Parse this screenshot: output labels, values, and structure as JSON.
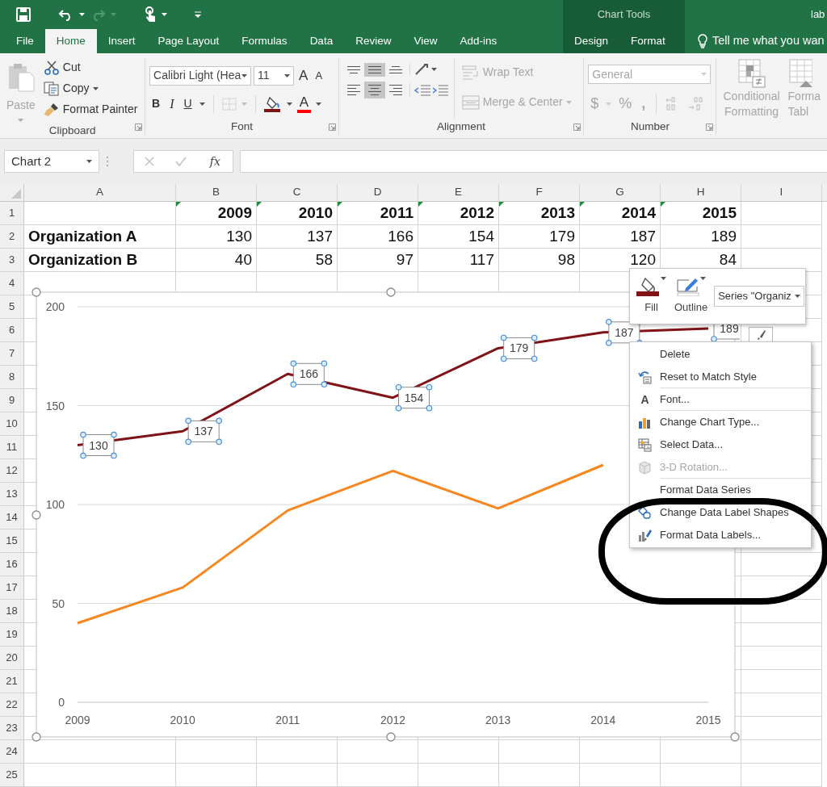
{
  "title_bar": {
    "context_group": "Chart Tools",
    "title": "lab"
  },
  "tabs": [
    {
      "label": "File",
      "selected": false,
      "kind": "standard"
    },
    {
      "label": "Home",
      "selected": true,
      "kind": "standard"
    },
    {
      "label": "Insert",
      "selected": false,
      "kind": "standard"
    },
    {
      "label": "Page Layout",
      "selected": false,
      "kind": "standard"
    },
    {
      "label": "Formulas",
      "selected": false,
      "kind": "standard"
    },
    {
      "label": "Data",
      "selected": false,
      "kind": "standard"
    },
    {
      "label": "Review",
      "selected": false,
      "kind": "standard"
    },
    {
      "label": "View",
      "selected": false,
      "kind": "standard"
    },
    {
      "label": "Add-ins",
      "selected": false,
      "kind": "standard"
    },
    {
      "label": "Design",
      "selected": false,
      "kind": "contextual"
    },
    {
      "label": "Format",
      "selected": false,
      "kind": "contextual"
    }
  ],
  "tell_me": "Tell me what you wan",
  "ribbon": {
    "clipboard": {
      "label": "Clipboard",
      "paste": {
        "label": "Paste",
        "disabled": true
      },
      "cut": "Cut",
      "copy": "Copy",
      "format_painter": "Format Painter"
    },
    "font": {
      "label": "Font",
      "font_name": "Calibri Light (Hea",
      "font_size": "11",
      "grow": "A",
      "shrink": "A",
      "bold": "B",
      "italic": "I",
      "underline": "U",
      "font_color": "A"
    },
    "alignment": {
      "label": "Alignment",
      "vertical": [
        {
          "selected": false
        },
        {
          "selected": true
        },
        {
          "selected": false
        }
      ],
      "horizontal": [
        {
          "selected": false
        },
        {
          "selected": true
        },
        {
          "selected": false
        }
      ],
      "wrap_text": "Wrap Text",
      "merge_center": "Merge & Center"
    },
    "number": {
      "label": "Number",
      "format": "General",
      "currency": "$",
      "percent": "%",
      "comma": ","
    },
    "styles": {
      "conditional_formatting": [
        "Conditional",
        "Formatting"
      ],
      "format_as_table": [
        "Forma",
        "Tabl"
      ]
    }
  },
  "formula_bar": {
    "name_box": "Chart 2",
    "function_label": "fx"
  },
  "sheet": {
    "columns": [
      "A",
      "B",
      "C",
      "D",
      "E",
      "F",
      "G",
      "H",
      "I"
    ],
    "rows": [
      {
        "header": "1",
        "kind": "years",
        "flagged": true,
        "values": [
          "2009",
          "2010",
          "2011",
          "2012",
          "2013",
          "2014",
          "2015"
        ]
      },
      {
        "header": "2",
        "kind": "data",
        "flagged": false,
        "label": "Organization A",
        "values": [
          "130",
          "137",
          "166",
          "154",
          "179",
          "187",
          "189"
        ]
      },
      {
        "header": "3",
        "kind": "data",
        "flagged": false,
        "label": "Organization B",
        "values": [
          "40",
          "58",
          "97",
          "117",
          "98",
          "120",
          "84"
        ]
      },
      {
        "header": "4",
        "kind": "blank",
        "flagged": false
      },
      {
        "header": "5",
        "kind": "blank",
        "flagged": false
      },
      {
        "header": "6",
        "kind": "blank",
        "flagged": false
      },
      {
        "header": "7",
        "kind": "blank",
        "flagged": false
      },
      {
        "header": "8",
        "kind": "blank",
        "flagged": false
      },
      {
        "header": "9",
        "kind": "blank",
        "flagged": false
      },
      {
        "header": "10",
        "kind": "blank",
        "flagged": false
      },
      {
        "header": "11",
        "kind": "blank",
        "flagged": false
      },
      {
        "header": "12",
        "kind": "blank",
        "flagged": false
      },
      {
        "header": "13",
        "kind": "blank",
        "flagged": false
      },
      {
        "header": "14",
        "kind": "blank",
        "flagged": false
      },
      {
        "header": "15",
        "kind": "blank",
        "flagged": false
      },
      {
        "header": "16",
        "kind": "blank",
        "flagged": false
      },
      {
        "header": "17",
        "kind": "blank",
        "flagged": false
      },
      {
        "header": "18",
        "kind": "blank",
        "flagged": false
      },
      {
        "header": "19",
        "kind": "blank",
        "flagged": false
      },
      {
        "header": "20",
        "kind": "blank",
        "flagged": false
      },
      {
        "header": "21",
        "kind": "blank",
        "flagged": false
      },
      {
        "header": "22",
        "kind": "blank",
        "flagged": false
      },
      {
        "header": "23",
        "kind": "blank",
        "flagged": false
      },
      {
        "header": "24",
        "kind": "blank",
        "flagged": false
      },
      {
        "header": "25",
        "kind": "blank",
        "flagged": false
      }
    ]
  },
  "chart": {
    "labels_selected": true,
    "chart_data": {
      "type": "line",
      "categories": [
        "2009",
        "2010",
        "2011",
        "2012",
        "2013",
        "2014",
        "2015"
      ],
      "series": [
        {
          "color": "#7f1315",
          "values": [
            130,
            137,
            166,
            154,
            179,
            187,
            189
          ]
        },
        {
          "color": "#f7861e",
          "values": [
            40,
            58,
            97,
            117,
            98,
            120,
            null
          ]
        }
      ],
      "grid": true,
      "ylim": [
        0,
        200
      ],
      "yticks": [
        0,
        50,
        100,
        150,
        200
      ],
      "value_labels": [
        "130",
        "137",
        "166",
        "154",
        "179",
        "187",
        "189"
      ]
    }
  },
  "mini_toolbar": {
    "fill": "Fill",
    "outline": "Outline",
    "series_selector": "Series \"Organiz"
  },
  "context_menu": {
    "items": [
      {
        "label": "Delete",
        "disabled": false,
        "separator_after": false
      },
      {
        "label": "Reset to Match Style",
        "disabled": false,
        "separator_after": true
      },
      {
        "label": "Font...",
        "glyph": "A",
        "disabled": false,
        "separator_after": true
      },
      {
        "label": "Change Chart Type...",
        "disabled": false,
        "separator_after": false
      },
      {
        "label": "Select Data...",
        "disabled": false,
        "separator_after": false
      },
      {
        "label": "3-D Rotation...",
        "disabled": true,
        "separator_after": true
      },
      {
        "label": "Format Data Series",
        "disabled": false,
        "separator_after": false
      },
      {
        "label": "Change Data Label Shapes",
        "disabled": false,
        "separator_after": false
      },
      {
        "label": "Format Data Labels...",
        "disabled": false,
        "separator_after": false
      }
    ]
  }
}
